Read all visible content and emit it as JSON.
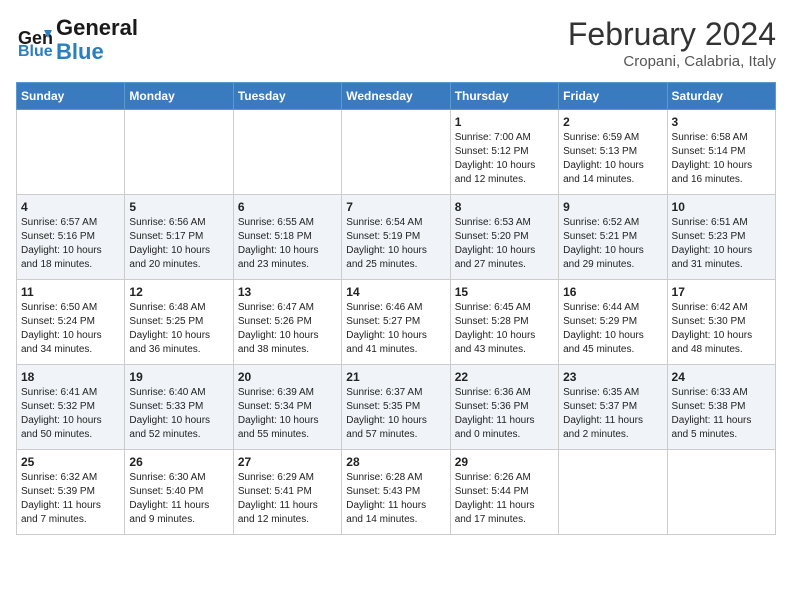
{
  "header": {
    "logo_line1": "General",
    "logo_line2": "Blue",
    "month": "February 2024",
    "location": "Cropani, Calabria, Italy"
  },
  "days_of_week": [
    "Sunday",
    "Monday",
    "Tuesday",
    "Wednesday",
    "Thursday",
    "Friday",
    "Saturday"
  ],
  "weeks": [
    [
      {
        "num": "",
        "info": ""
      },
      {
        "num": "",
        "info": ""
      },
      {
        "num": "",
        "info": ""
      },
      {
        "num": "",
        "info": ""
      },
      {
        "num": "1",
        "info": "Sunrise: 7:00 AM\nSunset: 5:12 PM\nDaylight: 10 hours\nand 12 minutes."
      },
      {
        "num": "2",
        "info": "Sunrise: 6:59 AM\nSunset: 5:13 PM\nDaylight: 10 hours\nand 14 minutes."
      },
      {
        "num": "3",
        "info": "Sunrise: 6:58 AM\nSunset: 5:14 PM\nDaylight: 10 hours\nand 16 minutes."
      }
    ],
    [
      {
        "num": "4",
        "info": "Sunrise: 6:57 AM\nSunset: 5:16 PM\nDaylight: 10 hours\nand 18 minutes."
      },
      {
        "num": "5",
        "info": "Sunrise: 6:56 AM\nSunset: 5:17 PM\nDaylight: 10 hours\nand 20 minutes."
      },
      {
        "num": "6",
        "info": "Sunrise: 6:55 AM\nSunset: 5:18 PM\nDaylight: 10 hours\nand 23 minutes."
      },
      {
        "num": "7",
        "info": "Sunrise: 6:54 AM\nSunset: 5:19 PM\nDaylight: 10 hours\nand 25 minutes."
      },
      {
        "num": "8",
        "info": "Sunrise: 6:53 AM\nSunset: 5:20 PM\nDaylight: 10 hours\nand 27 minutes."
      },
      {
        "num": "9",
        "info": "Sunrise: 6:52 AM\nSunset: 5:21 PM\nDaylight: 10 hours\nand 29 minutes."
      },
      {
        "num": "10",
        "info": "Sunrise: 6:51 AM\nSunset: 5:23 PM\nDaylight: 10 hours\nand 31 minutes."
      }
    ],
    [
      {
        "num": "11",
        "info": "Sunrise: 6:50 AM\nSunset: 5:24 PM\nDaylight: 10 hours\nand 34 minutes."
      },
      {
        "num": "12",
        "info": "Sunrise: 6:48 AM\nSunset: 5:25 PM\nDaylight: 10 hours\nand 36 minutes."
      },
      {
        "num": "13",
        "info": "Sunrise: 6:47 AM\nSunset: 5:26 PM\nDaylight: 10 hours\nand 38 minutes."
      },
      {
        "num": "14",
        "info": "Sunrise: 6:46 AM\nSunset: 5:27 PM\nDaylight: 10 hours\nand 41 minutes."
      },
      {
        "num": "15",
        "info": "Sunrise: 6:45 AM\nSunset: 5:28 PM\nDaylight: 10 hours\nand 43 minutes."
      },
      {
        "num": "16",
        "info": "Sunrise: 6:44 AM\nSunset: 5:29 PM\nDaylight: 10 hours\nand 45 minutes."
      },
      {
        "num": "17",
        "info": "Sunrise: 6:42 AM\nSunset: 5:30 PM\nDaylight: 10 hours\nand 48 minutes."
      }
    ],
    [
      {
        "num": "18",
        "info": "Sunrise: 6:41 AM\nSunset: 5:32 PM\nDaylight: 10 hours\nand 50 minutes."
      },
      {
        "num": "19",
        "info": "Sunrise: 6:40 AM\nSunset: 5:33 PM\nDaylight: 10 hours\nand 52 minutes."
      },
      {
        "num": "20",
        "info": "Sunrise: 6:39 AM\nSunset: 5:34 PM\nDaylight: 10 hours\nand 55 minutes."
      },
      {
        "num": "21",
        "info": "Sunrise: 6:37 AM\nSunset: 5:35 PM\nDaylight: 10 hours\nand 57 minutes."
      },
      {
        "num": "22",
        "info": "Sunrise: 6:36 AM\nSunset: 5:36 PM\nDaylight: 11 hours\nand 0 minutes."
      },
      {
        "num": "23",
        "info": "Sunrise: 6:35 AM\nSunset: 5:37 PM\nDaylight: 11 hours\nand 2 minutes."
      },
      {
        "num": "24",
        "info": "Sunrise: 6:33 AM\nSunset: 5:38 PM\nDaylight: 11 hours\nand 5 minutes."
      }
    ],
    [
      {
        "num": "25",
        "info": "Sunrise: 6:32 AM\nSunset: 5:39 PM\nDaylight: 11 hours\nand 7 minutes."
      },
      {
        "num": "26",
        "info": "Sunrise: 6:30 AM\nSunset: 5:40 PM\nDaylight: 11 hours\nand 9 minutes."
      },
      {
        "num": "27",
        "info": "Sunrise: 6:29 AM\nSunset: 5:41 PM\nDaylight: 11 hours\nand 12 minutes."
      },
      {
        "num": "28",
        "info": "Sunrise: 6:28 AM\nSunset: 5:43 PM\nDaylight: 11 hours\nand 14 minutes."
      },
      {
        "num": "29",
        "info": "Sunrise: 6:26 AM\nSunset: 5:44 PM\nDaylight: 11 hours\nand 17 minutes."
      },
      {
        "num": "",
        "info": ""
      },
      {
        "num": "",
        "info": ""
      }
    ]
  ]
}
